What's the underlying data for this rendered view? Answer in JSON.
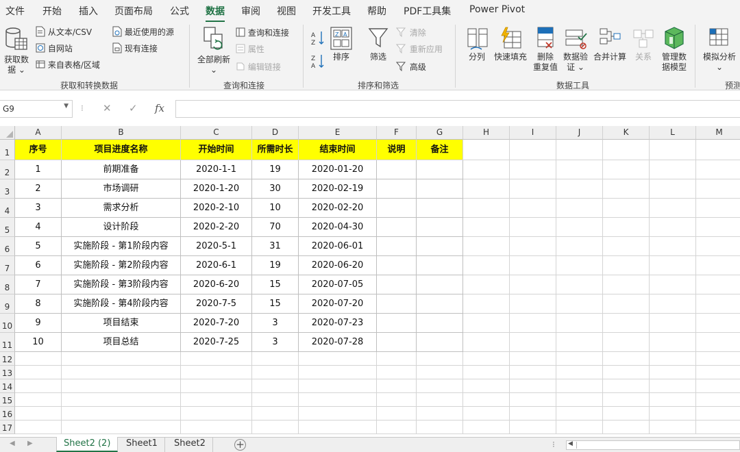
{
  "menu": {
    "tabs": [
      "文件",
      "开始",
      "插入",
      "页面布局",
      "公式",
      "数据",
      "审阅",
      "视图",
      "开发工具",
      "帮助",
      "PDF工具集",
      "Power Pivot"
    ],
    "active": "数据"
  },
  "ribbon": {
    "get_data": {
      "label1": "获取数",
      "label2": "据 ⌄"
    },
    "from_text_csv": "从文本/CSV",
    "from_web": "自网站",
    "from_table": "来自表格/区域",
    "recent_sources": "最近使用的源",
    "existing_connections": "现有连接",
    "group_get_transform": "获取和转换数据",
    "refresh_all": {
      "label1": "全部刷新",
      "label2": "⌄"
    },
    "queries_connections": "查询和连接",
    "properties": "属性",
    "edit_links": "编辑链接",
    "group_queries": "查询和连接",
    "sort": "排序",
    "filter": "筛选",
    "clear": "清除",
    "reapply": "重新应用",
    "advanced": "高级",
    "group_sort_filter": "排序和筛选",
    "text_to_columns": "分列",
    "flash_fill": "快速填充",
    "remove_duplicates": {
      "label1": "删除",
      "label2": "重复值"
    },
    "data_validation": {
      "label1": "数据验",
      "label2": "证 ⌄"
    },
    "consolidate": "合并计算",
    "relationships": "关系",
    "manage_data_model": {
      "label1": "管理数",
      "label2": "据模型"
    },
    "group_data_tools": "数据工具",
    "what_if": {
      "label1": "模拟分析",
      "label2": "⌄"
    },
    "group_forecast": "预测"
  },
  "formula_bar": {
    "name_box": "G9",
    "cancel": "✕",
    "enter": "✓",
    "fx": "fx",
    "value": ""
  },
  "columns": [
    "A",
    "B",
    "C",
    "D",
    "E",
    "F",
    "G",
    "H",
    "I",
    "J",
    "K",
    "L",
    "M"
  ],
  "rows": [
    "1",
    "2",
    "3",
    "4",
    "5",
    "6",
    "7",
    "8",
    "9",
    "10",
    "11",
    "12",
    "13",
    "14",
    "15",
    "16",
    "17"
  ],
  "table": {
    "headers": [
      "序号",
      "项目进度名称",
      "开始时间",
      "所需时长",
      "结束时间",
      "说明",
      "备注"
    ],
    "rows": [
      [
        "1",
        "前期准备",
        "2020-1-1",
        "19",
        "2020-01-20",
        "",
        ""
      ],
      [
        "2",
        "市场调研",
        "2020-1-20",
        "30",
        "2020-02-19",
        "",
        ""
      ],
      [
        "3",
        "需求分析",
        "2020-2-10",
        "10",
        "2020-02-20",
        "",
        ""
      ],
      [
        "4",
        "设计阶段",
        "2020-2-20",
        "70",
        "2020-04-30",
        "",
        ""
      ],
      [
        "5",
        "实施阶段 - 第1阶段内容",
        "2020-5-1",
        "31",
        "2020-06-01",
        "",
        ""
      ],
      [
        "6",
        "实施阶段 - 第2阶段内容",
        "2020-6-1",
        "19",
        "2020-06-20",
        "",
        ""
      ],
      [
        "7",
        "实施阶段 - 第3阶段内容",
        "2020-6-20",
        "15",
        "2020-07-05",
        "",
        ""
      ],
      [
        "8",
        "实施阶段 - 第4阶段内容",
        "2020-7-5",
        "15",
        "2020-07-20",
        "",
        ""
      ],
      [
        "9",
        "项目结束",
        "2020-7-20",
        "3",
        "2020-07-23",
        "",
        ""
      ],
      [
        "10",
        "项目总结",
        "2020-7-25",
        "3",
        "2020-07-28",
        "",
        ""
      ]
    ]
  },
  "sheets": [
    "Sheet2 (2)",
    "Sheet1",
    "Sheet2"
  ],
  "active_sheet": "Sheet2 (2)",
  "colors": {
    "accent": "#217346",
    "header_fill": "#ffff00"
  }
}
